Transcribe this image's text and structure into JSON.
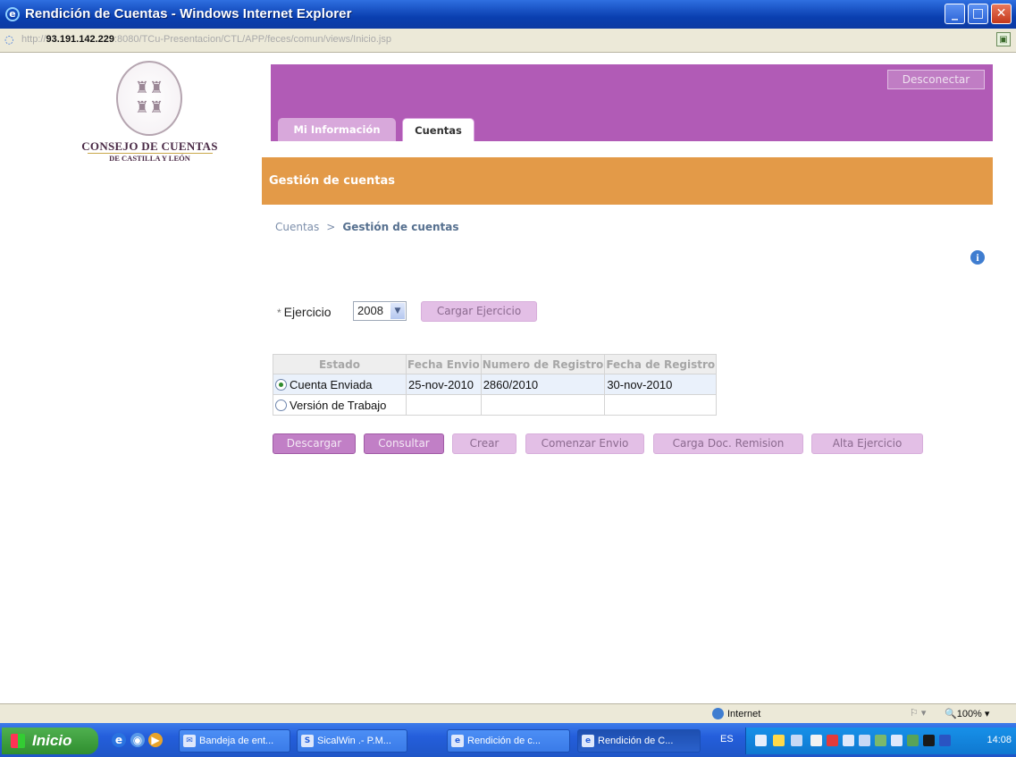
{
  "window": {
    "title": "Rendición de Cuentas - Windows Internet Explorer"
  },
  "address": {
    "url_prefix": "http://",
    "host": "93.191.142.229",
    "url_rest": ":8080/TCu-Presentacion/CTL/APP/feces/comun/views/Inicio.jsp"
  },
  "logo": {
    "line1": "CONSEJO DE CUENTAS",
    "line2": "DE CASTILLA Y LEÓN"
  },
  "header": {
    "disconnect_label": "Desconectar",
    "tabs": [
      {
        "label": "Mi Información"
      },
      {
        "label": "Cuentas"
      }
    ],
    "active_tab": "Cuentas"
  },
  "section": {
    "title": "Gestión de cuentas"
  },
  "breadcrumb": {
    "parent": "Cuentas",
    "separator": ">",
    "current": "Gestión de cuentas"
  },
  "form": {
    "required_mark": "*",
    "ejercicio_label": "Ejercicio",
    "ejercicio_value": "2008",
    "load_button": "Cargar Ejercicio"
  },
  "table": {
    "headers": [
      "Estado",
      "Fecha Envio",
      "Numero de Registro",
      "Fecha de Registro"
    ],
    "rows": [
      {
        "selected": true,
        "estado": "Cuenta Enviada",
        "fecha_envio": "25-nov-2010",
        "numero_registro": "2860/2010",
        "fecha_registro": "30-nov-2010"
      },
      {
        "selected": false,
        "estado": "Versión de Trabajo",
        "fecha_envio": "",
        "numero_registro": "",
        "fecha_registro": ""
      }
    ]
  },
  "actions": [
    "Descargar",
    "Consultar",
    "Crear",
    "Comenzar Envio",
    "Carga Doc. Remision",
    "Alta Ejercicio"
  ],
  "statusbar": {
    "zone": "Internet",
    "zoom": "100%"
  },
  "taskbar": {
    "start_label": "Inicio",
    "items": [
      "Bandeja de ent...",
      "SicalWin .- P.M...",
      "Rendición de c...",
      "Rendición de C..."
    ],
    "active_item": "Rendición de C...",
    "language": "ES",
    "clock": "14:08"
  },
  "colors": {
    "header_purple": "#b15bb6",
    "section_orange": "#e39a48",
    "tab_inactive": "#d8a8db"
  }
}
